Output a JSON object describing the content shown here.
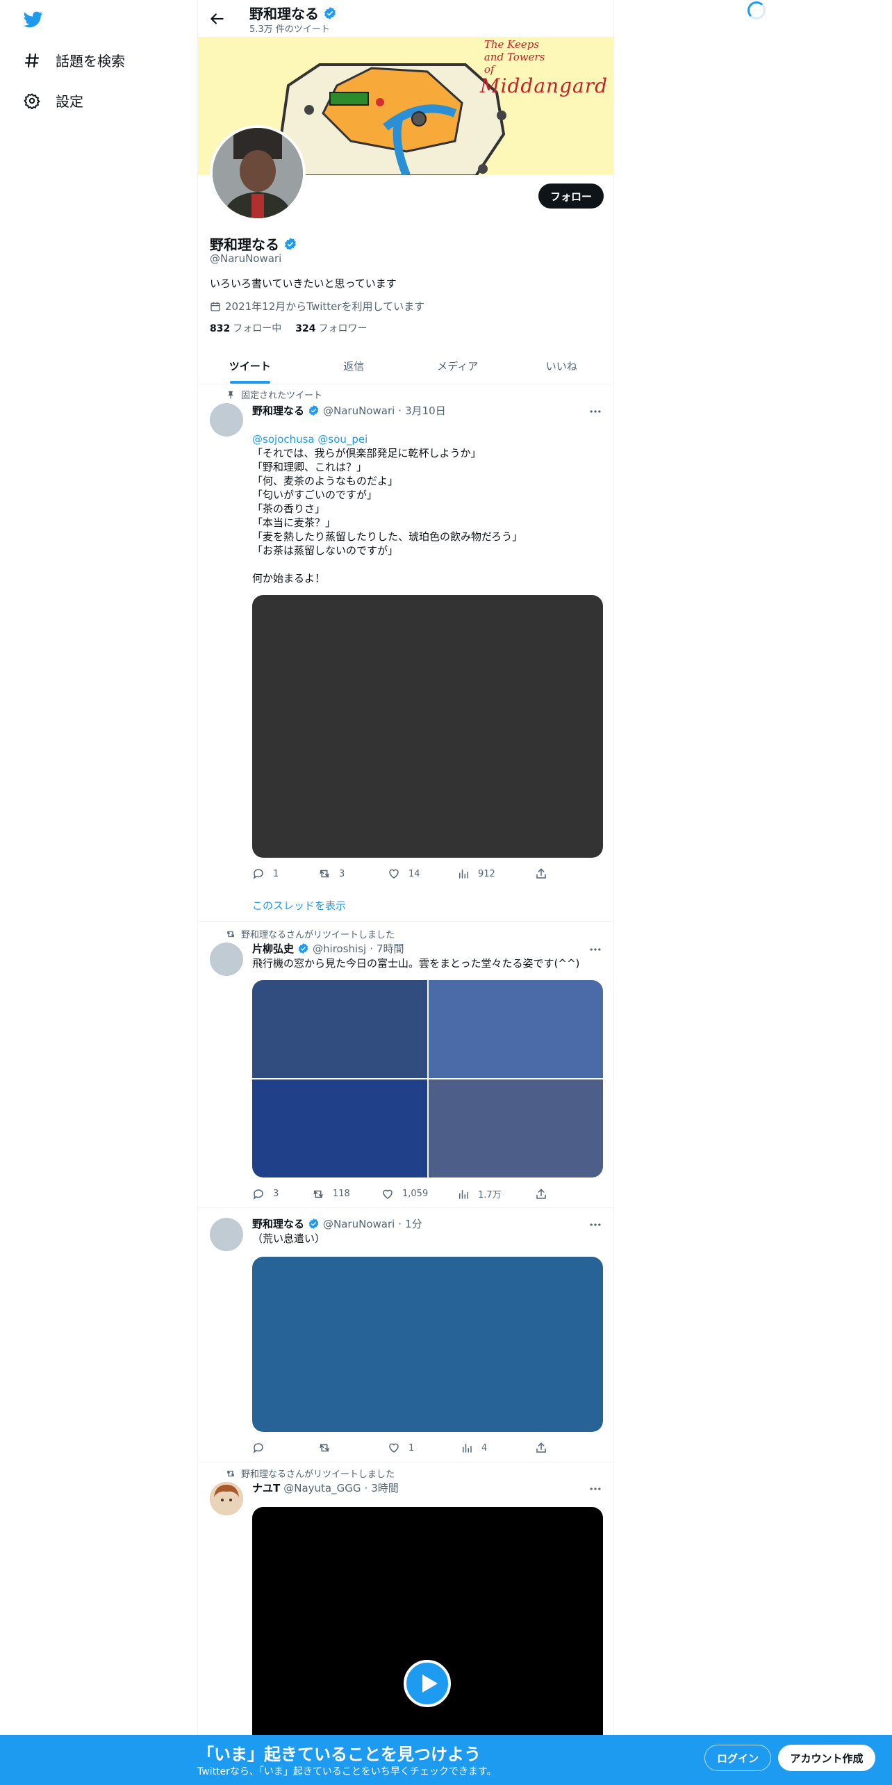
{
  "nav": {
    "logo_icon": "twitter-bird-icon",
    "explore_label": "話題を検索",
    "settings_label": "設定"
  },
  "header": {
    "name": "野和理なる",
    "tweet_count": "5.3万 件のツイート"
  },
  "banner": {
    "title_line1": "The Keeps",
    "title_line2": "and Towers",
    "title_line3": "of",
    "title_line4": "Middangard"
  },
  "profile": {
    "name": "野和理なる",
    "handle": "@NaruNowari",
    "bio": "いろいろ書いていきたいと思っています",
    "joined": "2021年12月からTwitterを利用しています",
    "following_count": "832",
    "following_label": "フォロー中",
    "followers_count": "324",
    "followers_label": "フォロワー",
    "follow_button": "フォロー"
  },
  "tabs": [
    "ツイート",
    "返信",
    "メディア",
    "いいね"
  ],
  "tweets": [
    {
      "pinned_label": "固定されたツイート",
      "name": "野和理なる",
      "handle": "@NaruNowari",
      "sep": "·",
      "time": "3月10日",
      "reply_to_1": "@sojochusa",
      "reply_to_2": "@sou_pei",
      "text": "「それでは、我らが倶楽部発足に乾杯しようか」\n「野和理卿、これは？」\n「何、麦茶のようなものだよ」\n「匂いがすごいのですが」\n「茶の香りさ」\n「本当に麦茶？」\n「麦を熱したり蒸留したりした、琥珀色の飲み物だろう」\n「お茶は蒸留しないのですが」\n\n何か始まるよ！",
      "replies": "1",
      "retweets": "3",
      "likes": "14",
      "views": "912",
      "thread_link": "このスレッドを表示",
      "media_color": "#333333"
    },
    {
      "social": "野和理なるさんがリツイートしました",
      "name": "片柳弘史",
      "handle": "@hiroshisj",
      "sep": "·",
      "time": "7時間",
      "text": "飛行機の窓から見た今日の富士山。雲をまとった堂々たる姿です(^^)",
      "replies": "3",
      "retweets": "118",
      "likes": "1,059",
      "views": "1.7万",
      "media_colors": [
        "#314d80",
        "#4a6aa8",
        "#21408a",
        "#4d5f88"
      ]
    },
    {
      "name": "野和理なる",
      "handle": "@NaruNowari",
      "sep": "·",
      "time": "1分",
      "text": "（荒い息遣い）",
      "replies": "",
      "retweets": "",
      "likes": "1",
      "views": "4",
      "media_color": "#276397"
    },
    {
      "social": "野和理なるさんがリツイートしました",
      "name": "ナユT",
      "handle": "@Nayuta_GGG",
      "sep": "·",
      "time": "3時間",
      "media_color": "#000000"
    }
  ],
  "bottom_bar": {
    "title": "「いま」起きていることを見つけよう",
    "subtitle": "Twitterなら、「いま」起きていることをいち早くチェックできます。",
    "login": "ログイン",
    "signup": "アカウント作成"
  }
}
